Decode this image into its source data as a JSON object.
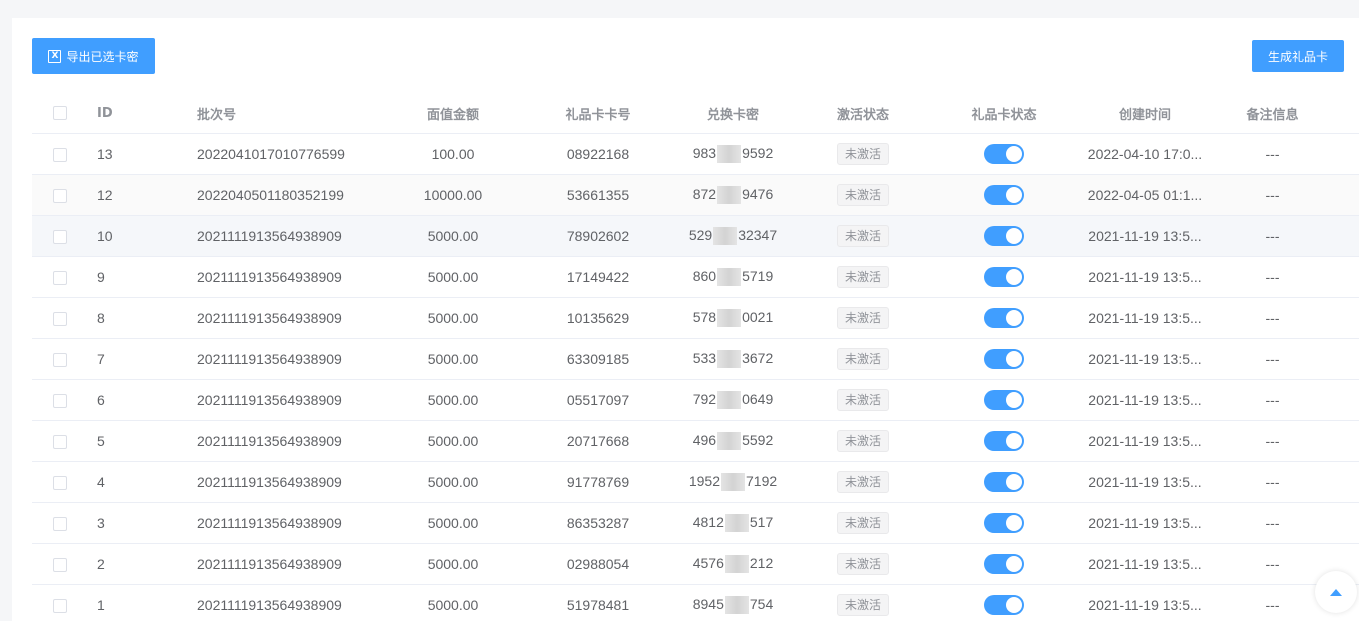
{
  "toolbar": {
    "export_label": "导出已选卡密",
    "export_icon": "excel-icon",
    "generate_label": "生成礼品卡"
  },
  "table": {
    "headers": [
      "ID",
      "批次号",
      "面值金额",
      "礼品卡卡号",
      "兑换卡密",
      "激活状态",
      "礼品卡状态",
      "创建时间",
      "备注信息"
    ],
    "rows": [
      {
        "id": "13",
        "batch": "2022041017010776599",
        "amount": "100.00",
        "card_no": "08922168",
        "pwd_start": "983",
        "pwd_end": "9592",
        "activation": "未激活",
        "enabled": true,
        "created": "2022-04-10 17:0...",
        "note": "---"
      },
      {
        "id": "12",
        "batch": "2022040501180352199",
        "amount": "10000.00",
        "card_no": "53661355",
        "pwd_start": "872",
        "pwd_end": "9476",
        "activation": "未激活",
        "enabled": true,
        "created": "2022-04-05 01:1...",
        "note": "---"
      },
      {
        "id": "10",
        "batch": "2021111913564938909",
        "amount": "5000.00",
        "card_no": "78902602",
        "pwd_start": "529",
        "pwd_end": "32347",
        "activation": "未激活",
        "enabled": true,
        "created": "2021-11-19 13:5...",
        "note": "---"
      },
      {
        "id": "9",
        "batch": "2021111913564938909",
        "amount": "5000.00",
        "card_no": "17149422",
        "pwd_start": "860",
        "pwd_end": "5719",
        "activation": "未激活",
        "enabled": true,
        "created": "2021-11-19 13:5...",
        "note": "---"
      },
      {
        "id": "8",
        "batch": "2021111913564938909",
        "amount": "5000.00",
        "card_no": "10135629",
        "pwd_start": "578",
        "pwd_end": "0021",
        "activation": "未激活",
        "enabled": true,
        "created": "2021-11-19 13:5...",
        "note": "---"
      },
      {
        "id": "7",
        "batch": "2021111913564938909",
        "amount": "5000.00",
        "card_no": "63309185",
        "pwd_start": "533",
        "pwd_end": "3672",
        "activation": "未激活",
        "enabled": true,
        "created": "2021-11-19 13:5...",
        "note": "---"
      },
      {
        "id": "6",
        "batch": "2021111913564938909",
        "amount": "5000.00",
        "card_no": "05517097",
        "pwd_start": "792",
        "pwd_end": "0649",
        "activation": "未激活",
        "enabled": true,
        "created": "2021-11-19 13:5...",
        "note": "---"
      },
      {
        "id": "5",
        "batch": "2021111913564938909",
        "amount": "5000.00",
        "card_no": "20717668",
        "pwd_start": "496",
        "pwd_end": "5592",
        "activation": "未激活",
        "enabled": true,
        "created": "2021-11-19 13:5...",
        "note": "---"
      },
      {
        "id": "4",
        "batch": "2021111913564938909",
        "amount": "5000.00",
        "card_no": "91778769",
        "pwd_start": "1952",
        "pwd_end": "7192",
        "activation": "未激活",
        "enabled": true,
        "created": "2021-11-19 13:5...",
        "note": "---"
      },
      {
        "id": "3",
        "batch": "2021111913564938909",
        "amount": "5000.00",
        "card_no": "86353287",
        "pwd_start": "4812",
        "pwd_end": "517",
        "activation": "未激活",
        "enabled": true,
        "created": "2021-11-19 13:5...",
        "note": "---"
      },
      {
        "id": "2",
        "batch": "2021111913564938909",
        "amount": "5000.00",
        "card_no": "02988054",
        "pwd_start": "4576",
        "pwd_end": "212",
        "activation": "未激活",
        "enabled": true,
        "created": "2021-11-19 13:5...",
        "note": "---"
      },
      {
        "id": "1",
        "batch": "2021111913564938909",
        "amount": "5000.00",
        "card_no": "51978481",
        "pwd_start": "8945",
        "pwd_end": "754",
        "activation": "未激活",
        "enabled": true,
        "created": "2021-11-19 13:5...",
        "note": "---"
      }
    ]
  },
  "colors": {
    "primary": "#409eff",
    "header_text": "#909399",
    "body_text": "#606266",
    "tag_bg": "#f4f4f5"
  },
  "back_to_top_icon": "caret-up-icon"
}
